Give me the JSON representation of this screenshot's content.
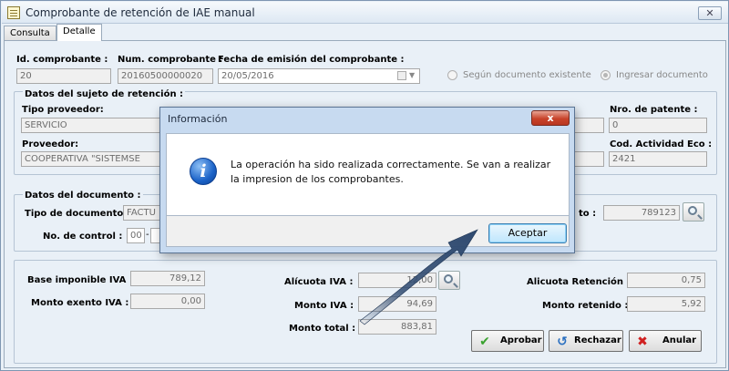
{
  "window": {
    "title": "Comprobante de retención de IAE manual",
    "close_glyph": "✕"
  },
  "tabs": [
    {
      "label": "Consulta"
    },
    {
      "label": "Detalle"
    }
  ],
  "header": {
    "id_label": "Id. comprobante :",
    "id_value": "20",
    "num_label": "Num. comprobante :",
    "num_value": "20160500000020",
    "fecha_label": "Fecha de emisión del comprobante :",
    "fecha_value": "20/05/2016",
    "radio_existente": "Según documento existente",
    "radio_ingresar": "Ingresar documento",
    "radio_selected": "ingresar"
  },
  "sujeto": {
    "group_label": "Datos del sujeto de retención :",
    "tipo_label": "Tipo proveedor:",
    "tipo_value": "SERVICIO",
    "proveedor_label": "Proveedor:",
    "proveedor_value": "COOPERATIVA \"SISTEMSE",
    "patente_label": "Nro. de patente :",
    "patente_value": "0",
    "actividad_label": "Cod. Actividad Eco :",
    "actividad_value": "2421"
  },
  "documento": {
    "group_label": "Datos del documento :",
    "tipo_label": "Tipo de documento:",
    "tipo_value": "FACTU",
    "control_label": "No. de control :",
    "control_value": "00",
    "monto_label_partial": "to :",
    "monto_value": "789123"
  },
  "totales": {
    "base_label": "Base imponible IVA :",
    "base_value": "789,12",
    "exento_label": "Monto exento IVA :",
    "exento_value": "0,00",
    "alicuota_label": "Alícuota IVA :",
    "alicuota_value": "12,00",
    "monto_iva_label": "Monto IVA :",
    "monto_iva_value": "94,69",
    "monto_total_label": "Monto total :",
    "monto_total_value": "883,81",
    "alicuota_ret_label": "Alicuota Retención :",
    "alicuota_ret_value": "0,75",
    "retenido_label": "Monto retenido :",
    "retenido_value": "5,92"
  },
  "actions": {
    "aprobar": "Aprobar",
    "rechazar": "Rechazar",
    "anular": "Anular"
  },
  "dialog": {
    "title": "Información",
    "close_glyph": "x",
    "message": "La operación ha sido realizada correctamente. Se van a realizar la impresion de los comprobantes.",
    "button": "Aceptar",
    "icon_glyph": "i"
  },
  "colors": {
    "accent_arrow": "#2f4a70",
    "approve_check": "#3aa22f",
    "reject_x": "#d02020"
  }
}
